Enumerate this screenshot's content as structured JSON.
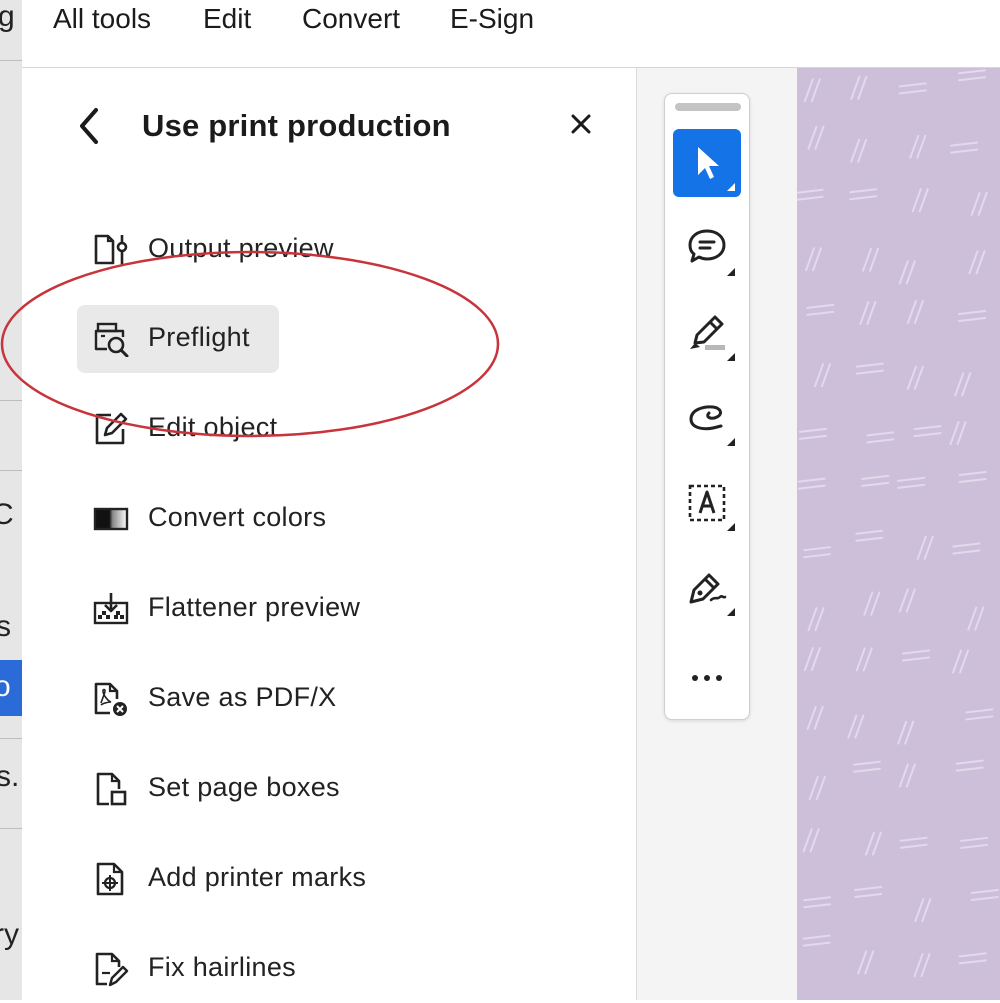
{
  "background_window": {
    "fragments": [
      "g",
      "C",
      "s",
      "o",
      "s..",
      "ry"
    ]
  },
  "menubar": {
    "items": [
      "All tools",
      "Edit",
      "Convert",
      "E-Sign"
    ]
  },
  "panel": {
    "title": "Use print production",
    "back_icon": "chevron-left-icon",
    "close_icon": "close-icon",
    "tools": [
      {
        "label": "Output preview",
        "icon": "output-preview-icon"
      },
      {
        "label": "Preflight",
        "icon": "preflight-icon",
        "selected": true
      },
      {
        "label": "Edit object",
        "icon": "edit-object-icon"
      },
      {
        "label": "Convert colors",
        "icon": "convert-colors-icon"
      },
      {
        "label": "Flattener preview",
        "icon": "flattener-preview-icon"
      },
      {
        "label": "Save as PDF/X",
        "icon": "save-pdfx-icon"
      },
      {
        "label": "Set page boxes",
        "icon": "set-page-boxes-icon"
      },
      {
        "label": "Add printer marks",
        "icon": "printer-marks-icon"
      },
      {
        "label": "Fix hairlines",
        "icon": "fix-hairlines-icon"
      }
    ]
  },
  "quick_tools": {
    "items": [
      {
        "icon": "select-cursor-icon",
        "active": true
      },
      {
        "icon": "comment-icon"
      },
      {
        "icon": "highlighter-icon"
      },
      {
        "icon": "draw-freehand-icon"
      },
      {
        "icon": "text-box-icon"
      },
      {
        "icon": "sign-pen-icon"
      },
      {
        "icon": "more-icon"
      }
    ]
  },
  "colors": {
    "accent": "#1473e6",
    "annotation": "#c8343c",
    "page_background": "#cdbfda"
  }
}
